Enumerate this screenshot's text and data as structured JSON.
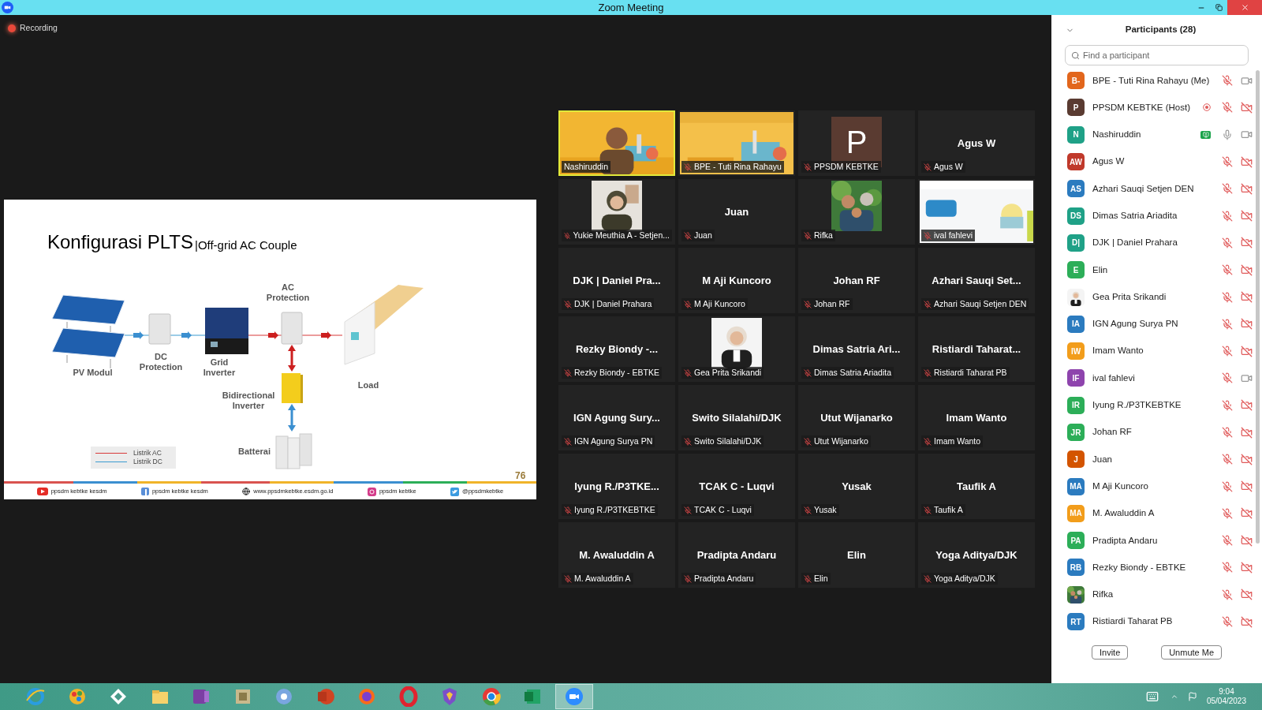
{
  "window": {
    "title": "Zoom Meeting"
  },
  "recording": {
    "label": "Recording"
  },
  "slide": {
    "title": "Konfigurasi PLTS",
    "subtitle": "|Off-grid AC Couple",
    "labels": {
      "pv": "PV Modul",
      "dc": "DC Protection",
      "inverter": "Grid Inverter",
      "ac": "AC Protection",
      "load": "Load",
      "bidirectional": "Bidirectional Inverter",
      "battery": "Batterai"
    },
    "legend": [
      {
        "label": "Listrik AC",
        "color": "#d83a3a"
      },
      {
        "label": "Listrik DC",
        "color": "#3b9bd0"
      }
    ],
    "page_number": "76",
    "footer": [
      {
        "kind": "youtube",
        "text": "ppsdm kebtke kesdm"
      },
      {
        "kind": "facebook",
        "text": "ppsdm kebtke kesdm"
      },
      {
        "kind": "web",
        "text": "www.ppsdmkebtke.esdm.go.id"
      },
      {
        "kind": "instagram",
        "text": "ppsdm kebtke"
      },
      {
        "kind": "twitter",
        "text": "@ppsdmkebtke"
      }
    ]
  },
  "gallery": [
    {
      "kind": "video",
      "name": "Nashiruddin",
      "muted": false,
      "speaking": true
    },
    {
      "kind": "video",
      "name": "BPE - Tuti Rina Rahayu",
      "muted": true,
      "speaking": false
    },
    {
      "kind": "avatar",
      "title": "P",
      "name": "PPSDM KEBTKE",
      "muted": true,
      "speaking": false
    },
    {
      "kind": "text",
      "title": "Agus W",
      "name": "Agus W",
      "muted": true,
      "speaking": false
    },
    {
      "name": "Yukie Meuthia A - Setjen...",
      "muted": true,
      "speaking": false
    },
    {
      "kind": "text",
      "title": "Juan",
      "name": "Juan",
      "muted": true,
      "speaking": false
    },
    {
      "name": "Rifka",
      "muted": true,
      "speaking": false
    },
    {
      "kind": "video",
      "name": "ival fahlevi",
      "muted": true,
      "speaking": false
    },
    {
      "kind": "text",
      "title": "DJK | Daniel Pra...",
      "name": "DJK | Daniel Prahara",
      "muted": true,
      "speaking": false
    },
    {
      "kind": "text",
      "title": "M Aji Kuncoro",
      "name": "M Aji Kuncoro",
      "muted": true,
      "speaking": false
    },
    {
      "kind": "text",
      "title": "Johan RF",
      "name": "Johan RF",
      "muted": true,
      "speaking": false
    },
    {
      "kind": "text",
      "title": "Azhari Sauqi Set...",
      "name": "Azhari Sauqi Setjen DEN",
      "muted": true,
      "speaking": false
    },
    {
      "kind": "text",
      "title": "Rezky Biondy -...",
      "name": "Rezky Biondy - EBTKE",
      "muted": true,
      "speaking": false
    },
    {
      "name": "Gea Prita Srikandi",
      "muted": true,
      "speaking": false
    },
    {
      "kind": "text",
      "title": "Dimas Satria Ari...",
      "name": "Dimas Satria Ariadita",
      "muted": true,
      "speaking": false
    },
    {
      "kind": "text",
      "title": "Ristiardi Taharat...",
      "name": "Ristiardi Taharat PB",
      "muted": true,
      "speaking": false
    },
    {
      "kind": "text",
      "title": "IGN Agung Sury...",
      "name": "IGN Agung Surya PN",
      "muted": true,
      "speaking": false
    },
    {
      "kind": "text",
      "title": "Swito Silalahi/DJK",
      "name": "Swito Silalahi/DJK",
      "muted": true,
      "speaking": false
    },
    {
      "kind": "text",
      "title": "Utut Wijanarko",
      "name": "Utut Wijanarko",
      "muted": true,
      "speaking": false
    },
    {
      "kind": "text",
      "title": "Imam Wanto",
      "name": "Imam Wanto",
      "muted": true,
      "speaking": false
    },
    {
      "kind": "text",
      "title": "Iyung R./P3TKE...",
      "name": "Iyung R./P3TKEBTKE",
      "muted": true,
      "speaking": false
    },
    {
      "kind": "text",
      "title": "TCAK C - Luqvi",
      "name": "TCAK C - Luqvi",
      "muted": true,
      "speaking": false
    },
    {
      "kind": "text",
      "title": "Yusak",
      "name": "Yusak",
      "muted": true,
      "speaking": false
    },
    {
      "kind": "text",
      "title": "Taufik A",
      "name": "Taufik A",
      "muted": true,
      "speaking": false
    },
    {
      "kind": "text",
      "title": "M. Awaluddin A",
      "name": "M. Awaluddin A",
      "muted": true,
      "speaking": false
    },
    {
      "kind": "text",
      "title": "Pradipta Andaru",
      "name": "Pradipta Andaru",
      "muted": true,
      "speaking": false
    },
    {
      "kind": "text",
      "title": "Elin",
      "name": "Elin",
      "muted": true,
      "speaking": false
    },
    {
      "kind": "text",
      "title": "Yoga Aditya/DJK",
      "name": "Yoga Aditya/DJK",
      "muted": true,
      "speaking": false
    }
  ],
  "participants": {
    "title": "Participants (28)",
    "search": {
      "placeholder": "Find a participant"
    },
    "items": [
      {
        "kind": "initials",
        "initials": "B-",
        "color": "#e2661c",
        "name": "BPE - Tuti Rina Rahayu (Me)",
        "muted": true,
        "video_off": false
      },
      {
        "kind": "initials",
        "initials": "P",
        "color": "#5a3b31",
        "name": "PPSDM KEBTKE (Host)",
        "muted": true,
        "video_off": true,
        "recording": true
      },
      {
        "kind": "initials",
        "initials": "N",
        "color": "#1fa187",
        "name": "Nashiruddin",
        "muted": false,
        "video_off": false,
        "sharing": true
      },
      {
        "kind": "initials",
        "initials": "AW",
        "color": "#c0392b",
        "name": "Agus W",
        "muted": true,
        "video_off": true
      },
      {
        "kind": "initials",
        "initials": "AS",
        "color": "#2b7bbf",
        "name": "Azhari Sauqi Setjen DEN",
        "muted": true,
        "video_off": true
      },
      {
        "kind": "initials",
        "initials": "DS",
        "color": "#1fa187",
        "name": "Dimas Satria Ariadita",
        "muted": true,
        "video_off": true
      },
      {
        "kind": "initials",
        "initials": "D|",
        "color": "#1fa187",
        "name": "DJK | Daniel Prahara",
        "muted": true,
        "video_off": true
      },
      {
        "kind": "initials",
        "initials": "E",
        "color": "#2cae58",
        "name": "Elin",
        "muted": true,
        "video_off": true
      },
      {
        "kind": "picture",
        "name": "Gea Prita Srikandi",
        "muted": true,
        "video_off": true
      },
      {
        "kind": "initials",
        "initials": "IA",
        "color": "#2b7bbf",
        "name": "IGN Agung Surya PN",
        "muted": true,
        "video_off": true
      },
      {
        "kind": "initials",
        "initials": "IW",
        "color": "#f29d1b",
        "name": "Imam Wanto",
        "muted": true,
        "video_off": true
      },
      {
        "kind": "initials",
        "initials": "IF",
        "color": "#8e44ad",
        "name": "ival fahlevi",
        "muted": true,
        "video_off": false
      },
      {
        "kind": "initials",
        "initials": "IR",
        "color": "#2cae58",
        "name": "Iyung R./P3TKEBTKE",
        "muted": true,
        "video_off": true
      },
      {
        "kind": "initials",
        "initials": "JR",
        "color": "#2cae58",
        "name": "Johan RF",
        "muted": true,
        "video_off": true
      },
      {
        "kind": "initials",
        "initials": "J",
        "color": "#d35400",
        "name": "Juan",
        "muted": true,
        "video_off": true
      },
      {
        "kind": "initials",
        "initials": "MA",
        "color": "#2b7bbf",
        "name": "M Aji Kuncoro",
        "muted": true,
        "video_off": true
      },
      {
        "kind": "initials",
        "initials": "MA",
        "color": "#f29d1b",
        "name": "M. Awaluddin A",
        "muted": true,
        "video_off": true
      },
      {
        "kind": "initials",
        "initials": "PA",
        "color": "#2cae58",
        "name": "Pradipta Andaru",
        "muted": true,
        "video_off": true
      },
      {
        "kind": "initials",
        "initials": "RB",
        "color": "#2b7bbf",
        "name": "Rezky Biondy - EBTKE",
        "muted": true,
        "video_off": true
      },
      {
        "kind": "picture",
        "name": "Rifka",
        "muted": true,
        "video_off": true
      },
      {
        "kind": "initials",
        "initials": "RT",
        "color": "#2b7bbf",
        "name": "Ristiardi Taharat PB",
        "muted": true,
        "video_off": true
      }
    ],
    "buttons": [
      "Invite",
      "Unmute Me"
    ]
  },
  "taskbar": {
    "apps": [
      {
        "kind": "ie",
        "active": false
      },
      {
        "kind": "paint",
        "active": false
      },
      {
        "kind": "diamond",
        "active": false
      },
      {
        "kind": "folder",
        "active": false
      },
      {
        "kind": "onenote",
        "active": false
      },
      {
        "kind": "archive",
        "active": false
      },
      {
        "kind": "chromium",
        "active": false
      },
      {
        "kind": "powerpoint",
        "active": false
      },
      {
        "kind": "firefox",
        "active": false
      },
      {
        "kind": "opera",
        "active": false
      },
      {
        "kind": "brave",
        "active": false
      },
      {
        "kind": "chrome",
        "active": false
      },
      {
        "kind": "excel",
        "active": false
      },
      {
        "kind": "zoom",
        "active": true
      }
    ],
    "time": "9:04",
    "date": "05/04/2023"
  }
}
